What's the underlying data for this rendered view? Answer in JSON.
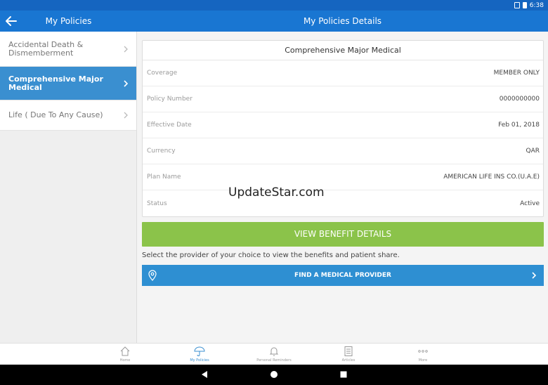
{
  "status_bar": {
    "time": "6:38"
  },
  "appbar": {
    "left_title": "My Policies",
    "right_title": "My Policies Details"
  },
  "sidebar": {
    "items": [
      {
        "label": "Accidental Death & Dismemberment",
        "active": false
      },
      {
        "label": "Comprehensive Major Medical",
        "active": true
      },
      {
        "label": "Life ( Due To Any Cause)",
        "active": false
      }
    ]
  },
  "details": {
    "title": "Comprehensive Major Medical",
    "rows": [
      {
        "label": "Coverage",
        "value": "MEMBER ONLY"
      },
      {
        "label": "Policy Number",
        "value": "0000000000"
      },
      {
        "label": "Effective Date",
        "value": "Feb 01, 2018"
      },
      {
        "label": "Currency",
        "value": "QAR"
      },
      {
        "label": "Plan Name",
        "value": "AMERICAN LIFE INS CO.(U.A.E)"
      },
      {
        "label": "Status",
        "value": "Active"
      }
    ]
  },
  "watermark": "UpdateStar.com",
  "benefit_button": "VIEW BENEFIT DETAILS",
  "provider_note": "Select the provider of your choice to view the benefits and patient share.",
  "find_provider_button": "FIND A MEDICAL PROVIDER",
  "tabs": [
    {
      "label": "Home",
      "icon": "home-icon"
    },
    {
      "label": "My Policies",
      "icon": "umbrella-icon",
      "active": true
    },
    {
      "label": "Personal Reminders",
      "icon": "bell-icon"
    },
    {
      "label": "Articles",
      "icon": "article-icon"
    },
    {
      "label": "More",
      "icon": "more-dots-icon"
    }
  ],
  "colors": {
    "primary": "#1976d2",
    "status_bar": "#1565c0",
    "active_item": "#3a8fd0",
    "benefit": "#8bc34a",
    "find": "#2e8fd2"
  }
}
